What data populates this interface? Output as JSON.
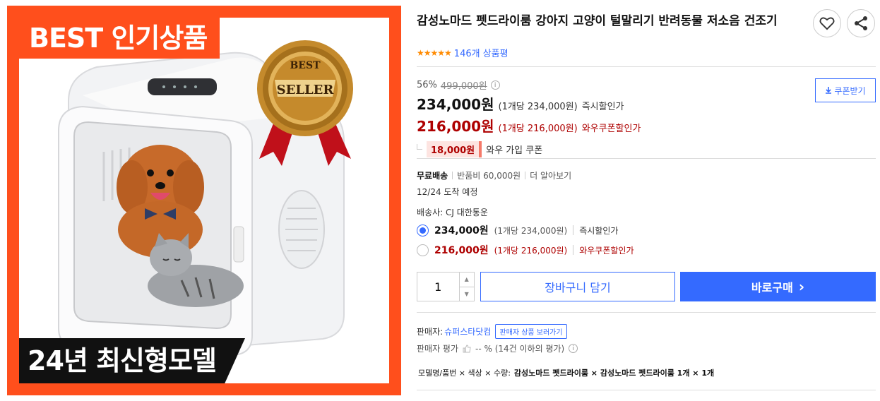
{
  "image": {
    "best_banner": "BEST 인기상품",
    "model_banner": "24년 최신형모델",
    "seal_line1": "BEST",
    "seal_line2": "SELLER",
    "colors": {
      "frame": "#ff4f1c",
      "banner_dark": "#111111",
      "seal_gold": "#c48a2c",
      "ribbon": "#c0101a"
    }
  },
  "product": {
    "title": "감성노마드 펫드라이룸 강아지 고양이 털말리기 반려동물 저소음 건조기",
    "stars": "★★★★★",
    "review_count": "146개 상품평"
  },
  "price": {
    "discount_rate": "56%",
    "original_price": "499,000원",
    "info_icon": "i",
    "sale_price": "234,000원",
    "sale_unit": "(1개당 234,000원)",
    "sale_label": "즉시할인가",
    "wow_price": "216,000원",
    "wow_unit": "(1개당 216,000원)",
    "wow_label": "와우쿠폰할인가",
    "coupon_amount": "18,000원",
    "coupon_label": "와우 가입 쿠폰",
    "coupon_button": "쿠폰받기"
  },
  "shipping": {
    "free": "무료배송",
    "return_fee": "반품비 60,000원",
    "more": "더 알아보기",
    "arrival": "12/24 도착 예정",
    "carrier": "배송사: CJ 대한통운"
  },
  "options": [
    {
      "price": "234,000원",
      "unit": "(1개당 234,000원)",
      "label": "즉시할인가",
      "selected": true
    },
    {
      "price": "216,000원",
      "unit": "(1개당 216,000원)",
      "label": "와우쿠폰할인가",
      "selected": false
    }
  ],
  "purchase": {
    "quantity": "1",
    "up": "▲",
    "down": "▼",
    "cart": "장바구니 담기",
    "buy": "바로구매",
    "buy_arrow": "›"
  },
  "seller": {
    "label": "판매자:",
    "name": "슈퍼스타닷컴",
    "bubble": "판매자 상품 보러가기",
    "rating_label": "판매자 평가",
    "rating_value": "-- % (14건 이하의 평가)"
  },
  "option_summary": {
    "label": "모델명/품번 × 색상 × 수량:",
    "value": "감성노마드 펫드라이룸 × 감성노마드 펫드라이룸 1개 × 1개"
  },
  "colors": {
    "accent_blue": "#346aff",
    "price_red": "#ae0000",
    "star_orange": "#ff8a00"
  }
}
